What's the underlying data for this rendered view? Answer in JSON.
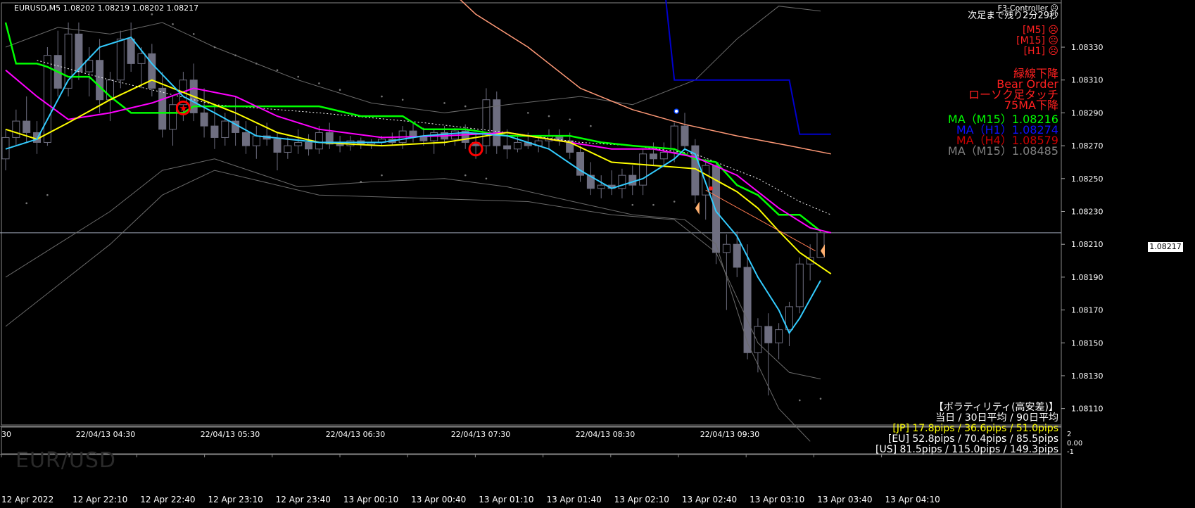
{
  "header": {
    "symbol_line": "EURUSD,M5  1.08202 1.08219 1.08202 1.08217",
    "controller": "F3-Controller ☹",
    "countdown": "次足まで残り2分29秒"
  },
  "signals": [
    "[M5] ☹",
    "[M15] ☹",
    "[H1] ☹"
  ],
  "alerts": [
    "緑線下降",
    "Bear Order",
    "ローソク足タッチ",
    "75MA下降"
  ],
  "ma_panel": [
    {
      "text": "MA（M15）1.08216",
      "color": "#00ff00"
    },
    {
      "text": "MA（H1）1.08274",
      "color": "#1010ff"
    },
    {
      "text": "MA（H4）1.08579",
      "color": "#cc0000"
    },
    {
      "text": "MA（M15）1.08485",
      "color": "#808080"
    }
  ],
  "volatility": {
    "title": "【ボラティリティ(高安差)】",
    "subtitle": "当日 / 30日平均 / 90日平均",
    "rows": [
      {
        "text": "[JP] 17.8pips / 36.6pips / 51.0pips",
        "color": "#ffff00"
      },
      {
        "text": "[EU] 52.8pips / 70.4pips / 85.5pips",
        "color": "#ffffff"
      },
      {
        "text": "[US] 81.5pips / 115.0pips / 149.3pips",
        "color": "#ffffff"
      }
    ]
  },
  "watermark": "EUR/USD",
  "current_price": "1.08217",
  "price_axis": [
    "1.08330",
    "1.08310",
    "1.08290",
    "1.08270",
    "1.08250",
    "1.08230",
    "1.08210",
    "1.08190",
    "1.08170",
    "1.08150",
    "1.08130",
    "1.08110"
  ],
  "upper_time_axis": [
    "30",
    "22/04/13 04:30",
    "22/04/13 05:30",
    "22/04/13 06:30",
    "22/04/13 07:30",
    "22/04/13 08:30",
    "22/04/13 09:30"
  ],
  "lower_time_axis": [
    "12 Apr 2022",
    "12 Apr 22:10",
    "12 Apr 22:40",
    "12 Apr 23:10",
    "12 Apr 23:40",
    "13 Apr 00:10",
    "13 Apr 00:40",
    "13 Apr 01:10",
    "13 Apr 01:40",
    "13 Apr 02:10",
    "13 Apr 02:40",
    "13 Apr 03:10",
    "13 Apr 03:40",
    "13 Apr 04:10"
  ],
  "sub_axis": [
    "2",
    "0.00",
    "-1"
  ],
  "colors": {
    "ma_green": "#00ff00",
    "ma_yellow": "#ffff00",
    "ma_magenta": "#ff00ff",
    "ma_cyan": "#33ccff",
    "ma_salmon": "#ff9977",
    "ma_blue": "#0000cc",
    "bollinger": "#6a6a6a",
    "candle": "#6e6e80"
  },
  "candles": [
    [
      1.08262,
      1.0828,
      1.08255,
      1.08275
    ],
    [
      1.08275,
      1.08292,
      1.0827,
      1.08285
    ],
    [
      1.08285,
      1.083,
      1.08272,
      1.08278
    ],
    [
      1.08278,
      1.08285,
      1.08265,
      1.08272
    ],
    [
      1.08272,
      1.0833,
      1.0827,
      1.08325
    ],
    [
      1.08325,
      1.0834,
      1.083,
      1.08305
    ],
    [
      1.08305,
      1.08345,
      1.083,
      1.08338
    ],
    [
      1.08338,
      1.08345,
      1.0831,
      1.08315
    ],
    [
      1.08315,
      1.0833,
      1.083,
      1.08322
    ],
    [
      1.08322,
      1.08335,
      1.0829,
      1.08298
    ],
    [
      1.08298,
      1.08315,
      1.08285,
      1.0831
    ],
    [
      1.0831,
      1.0834,
      1.08305,
      1.08335
    ],
    [
      1.08335,
      1.08345,
      1.08315,
      1.0832
    ],
    [
      1.0832,
      1.0833,
      1.08305,
      1.08326
    ],
    [
      1.08326,
      1.08332,
      1.083,
      1.08305
    ],
    [
      1.08305,
      1.08315,
      1.08275,
      1.0828
    ],
    [
      1.0828,
      1.083,
      1.0827,
      1.08295
    ],
    [
      1.08295,
      1.08315,
      1.08285,
      1.0831
    ],
    [
      1.0831,
      1.0832,
      1.08285,
      1.0829
    ],
    [
      1.0829,
      1.08305,
      1.08275,
      1.08282
    ],
    [
      1.08282,
      1.08295,
      1.08268,
      1.08275
    ],
    [
      1.08275,
      1.0829,
      1.0827,
      1.08285
    ],
    [
      1.08285,
      1.083,
      1.0827,
      1.08278
    ],
    [
      1.08278,
      1.08285,
      1.08265,
      1.0827
    ],
    [
      1.0827,
      1.08282,
      1.08262,
      1.08276
    ],
    [
      1.08276,
      1.08284,
      1.0827,
      1.08274
    ],
    [
      1.08274,
      1.08278,
      1.08255,
      1.08266
    ],
    [
      1.08266,
      1.08275,
      1.08262,
      1.0827
    ],
    [
      1.0827,
      1.0828,
      1.08265,
      1.08272
    ],
    [
      1.08272,
      1.08277,
      1.08264,
      1.08268
    ],
    [
      1.08268,
      1.08282,
      1.08265,
      1.08278
    ],
    [
      1.08278,
      1.08284,
      1.08268,
      1.08271
    ],
    [
      1.08271,
      1.08276,
      1.08266,
      1.0827
    ],
    [
      1.0827,
      1.08276,
      1.08267,
      1.08273
    ],
    [
      1.08273,
      1.08275,
      1.08268,
      1.08271
    ],
    [
      1.08271,
      1.08274,
      1.08268,
      1.08272
    ],
    [
      1.08272,
      1.08276,
      1.0827,
      1.08274
    ],
    [
      1.08274,
      1.08278,
      1.0827,
      1.08272
    ],
    [
      1.08272,
      1.08282,
      1.08268,
      1.08279
    ],
    [
      1.08279,
      1.08284,
      1.08272,
      1.08276
    ],
    [
      1.08276,
      1.08281,
      1.0827,
      1.08273
    ],
    [
      1.08273,
      1.0828,
      1.08265,
      1.08278
    ],
    [
      1.08278,
      1.08282,
      1.0827,
      1.08274
    ],
    [
      1.08274,
      1.08281,
      1.0827,
      1.08279
    ],
    [
      1.08279,
      1.08283,
      1.08268,
      1.08272
    ],
    [
      1.08272,
      1.08278,
      1.08262,
      1.0827
    ],
    [
      1.0827,
      1.08305,
      1.08265,
      1.08298
    ],
    [
      1.08298,
      1.08303,
      1.08265,
      1.0827
    ],
    [
      1.0827,
      1.0828,
      1.08262,
      1.08268
    ],
    [
      1.08268,
      1.08276,
      1.08266,
      1.08272
    ],
    [
      1.08272,
      1.08278,
      1.08268,
      1.0827
    ],
    [
      1.0827,
      1.08276,
      1.08266,
      1.08273
    ],
    [
      1.08273,
      1.0828,
      1.08268,
      1.08276
    ],
    [
      1.08276,
      1.0828,
      1.0827,
      1.08273
    ],
    [
      1.08273,
      1.08278,
      1.08262,
      1.08266
    ],
    [
      1.08266,
      1.0827,
      1.08248,
      1.08252
    ],
    [
      1.08252,
      1.0826,
      1.0824,
      1.08244
    ],
    [
      1.08244,
      1.08252,
      1.08238,
      1.08246
    ],
    [
      1.08246,
      1.08255,
      1.0824,
      1.08244
    ],
    [
      1.08244,
      1.08256,
      1.08238,
      1.08252
    ],
    [
      1.08252,
      1.08258,
      1.0824,
      1.08246
    ],
    [
      1.08246,
      1.08268,
      1.0824,
      1.08265
    ],
    [
      1.08265,
      1.08272,
      1.08258,
      1.08262
    ],
    [
      1.08262,
      1.08272,
      1.08258,
      1.08266
    ],
    [
      1.08266,
      1.08284,
      1.0826,
      1.08282
    ],
    [
      1.08282,
      1.0829,
      1.08268,
      1.0827
    ],
    [
      1.0827,
      1.08274,
      1.08235,
      1.0824
    ],
    [
      1.0824,
      1.08262,
      1.08225,
      1.08258
    ],
    [
      1.08258,
      1.0826,
      1.08198,
      1.08205
    ],
    [
      1.08205,
      1.08216,
      1.0817,
      1.0821
    ],
    [
      1.0821,
      1.08218,
      1.0819,
      1.08196
    ],
    [
      1.08196,
      1.0821,
      1.0814,
      1.08144
    ],
    [
      1.08144,
      1.08165,
      1.08132,
      1.0816
    ],
    [
      1.0816,
      1.08168,
      1.08118,
      1.0815
    ],
    [
      1.0815,
      1.08162,
      1.0814,
      1.08158
    ],
    [
      1.08158,
      1.08175,
      1.08148,
      1.08172
    ],
    [
      1.08172,
      1.08202,
      1.08168,
      1.08198
    ],
    [
      1.08198,
      1.0821,
      1.08188,
      1.08202
    ],
    [
      1.08202,
      1.08219,
      1.08202,
      1.08217
    ]
  ]
}
